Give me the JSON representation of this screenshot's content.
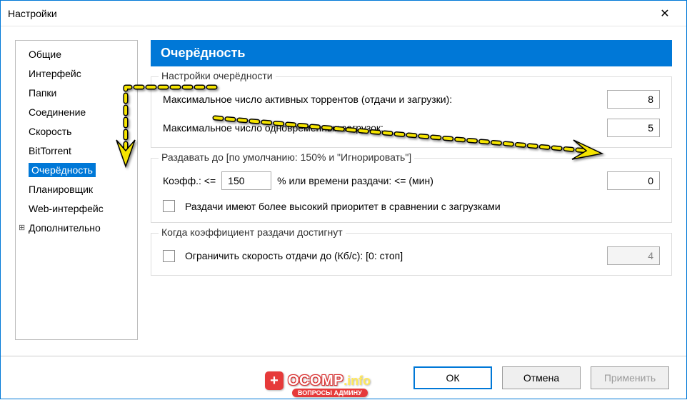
{
  "window": {
    "title": "Настройки"
  },
  "sidebar": {
    "items": [
      {
        "label": "Общие",
        "selected": false,
        "expandable": false
      },
      {
        "label": "Интерфейс",
        "selected": false,
        "expandable": false
      },
      {
        "label": "Папки",
        "selected": false,
        "expandable": false
      },
      {
        "label": "Соединение",
        "selected": false,
        "expandable": false
      },
      {
        "label": "Скорость",
        "selected": false,
        "expandable": false
      },
      {
        "label": "BitTorrent",
        "selected": false,
        "expandable": false
      },
      {
        "label": "Очерёдность",
        "selected": true,
        "expandable": false
      },
      {
        "label": "Планировщик",
        "selected": false,
        "expandable": false
      },
      {
        "label": "Web-интерфейс",
        "selected": false,
        "expandable": false
      },
      {
        "label": "Дополнительно",
        "selected": false,
        "expandable": true
      }
    ]
  },
  "main": {
    "heading": "Очерёдность",
    "group1": {
      "legend": "Настройки очерёдности",
      "max_active_label": "Максимальное число активных торрентов (отдачи и загрузки):",
      "max_active_value": "8",
      "max_downloads_label": "Максимальное число одновременных загрузок:",
      "max_downloads_value": "5"
    },
    "group2": {
      "legend": "Раздавать до   [по умолчанию: 150% и \"Игнорировать\"]",
      "ratio_prefix": "Коэфф.: <=",
      "ratio_value": "150",
      "ratio_suffix": "% или времени раздачи: <= (мин)",
      "minutes_value": "0",
      "priority_checkbox_label": "Раздачи имеют более высокий приоритет в сравнении с загрузками"
    },
    "group3": {
      "legend": "Когда коэффициент раздачи достигнут",
      "limit_upload_label": "Ограничить скорость отдачи до (Кб/с): [0: стоп]",
      "limit_upload_value": "4"
    }
  },
  "buttons": {
    "ok": "ОК",
    "cancel": "Отмена",
    "apply": "Применить"
  },
  "watermark": {
    "main": "OCOMP",
    "suffix": ".info",
    "sub": "ВОПРОСЫ АДМИНУ"
  }
}
